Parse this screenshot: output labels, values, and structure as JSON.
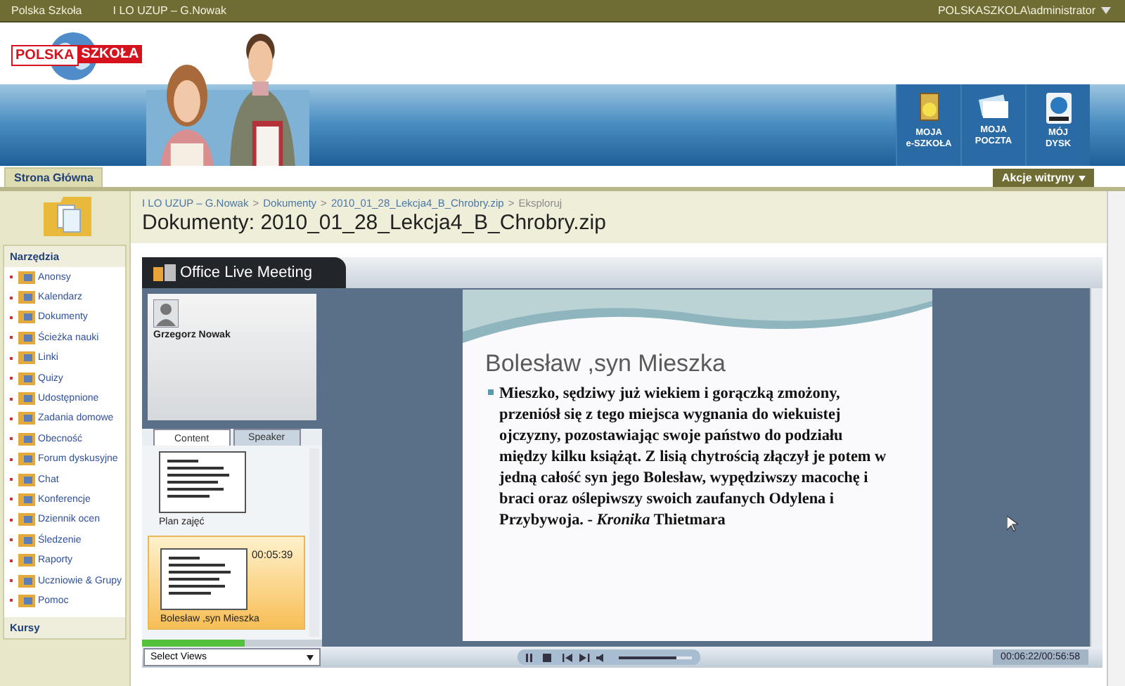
{
  "top_bar": {
    "site": "Polska Szkoła",
    "subsite": "I LO UZUP – G.Nowak",
    "user": "POLSKASZKOLA\\administrator"
  },
  "logo": {
    "part1": "POLSKA",
    "part2": "SZKOŁA"
  },
  "quick_links": [
    {
      "kind": "school",
      "line1": "MOJA",
      "line2": "e-SZKOŁA"
    },
    {
      "kind": "mail",
      "line1": "MOJA",
      "line2": "POCZTA"
    },
    {
      "kind": "disk",
      "line1": "MÓJ",
      "line2": "DYSK"
    }
  ],
  "nav": {
    "tabs": [
      {
        "label": "Strona Główna",
        "selected": true
      }
    ],
    "site_actions": "Akcje witryny"
  },
  "sidebar": {
    "section": "Narzędzia",
    "items": [
      {
        "label": "Anonsy"
      },
      {
        "label": "Kalendarz"
      },
      {
        "label": "Dokumenty"
      },
      {
        "label": "Ścieżka nauki"
      },
      {
        "label": "Linki"
      },
      {
        "label": "Quizy"
      },
      {
        "label": "Udostępnione"
      },
      {
        "label": "Zadania domowe"
      },
      {
        "label": "Obecność"
      },
      {
        "label": "Forum dyskusyjne"
      },
      {
        "label": "Chat"
      },
      {
        "label": "Konferencje"
      },
      {
        "label": "Dziennik ocen"
      },
      {
        "label": "Śledzenie"
      },
      {
        "label": "Raporty"
      },
      {
        "label": "Uczniowie & Grupy"
      },
      {
        "label": "Pomoc"
      }
    ],
    "footer": "Kursy"
  },
  "breadcrumb": {
    "separator": ">",
    "items": [
      "I LO UZUP – G.Nowak",
      "Dokumenty",
      "2010_01_28_Lekcja4_B_Chrobry.zip",
      "Eksploruj"
    ]
  },
  "title": "Dokumenty: 2010_01_28_Lekcja4_B_Chrobry.zip",
  "player": {
    "brand": "Office Live Meeting",
    "speaker": "Grzegorz Nowak",
    "tabs": [
      {
        "label": "Content",
        "selected": true
      },
      {
        "label": "Speaker",
        "selected": false
      }
    ],
    "slides": [
      {
        "title": "Plan zajęć",
        "selected": false
      },
      {
        "title": "Bolesław ,syn Mieszka",
        "time": "00:05:39",
        "selected": true
      }
    ],
    "progress": {
      "level": 0.57
    },
    "views": "Select Views",
    "slide": {
      "title": "Bolesław ,syn Mieszka",
      "bullet": "Mieszko, sędziwy już wiekiem i gorączką zmożony, przeniósł się z tego miejsca wygnania do wiekuistej ojczyzny, pozostawiając swoje państwo do podziału między kilku książąt. Z lisią chytrością złączył je potem w jedną całość syn jego Bolesław, wypędziwszy macochę i braci oraz oślepiwszy swoich zaufanych Odylena i Przybywoja. - *Kronika* Thietmara"
    },
    "seek": {
      "level": 0.78
    },
    "time": "00:06:22/00:56:58"
  }
}
